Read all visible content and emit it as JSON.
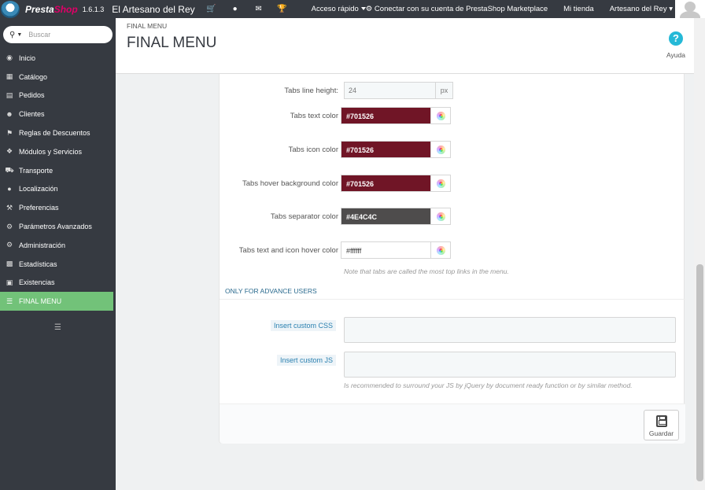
{
  "header": {
    "brand_a": "Presta",
    "brand_b": "Shop",
    "version": "1.6.1.3",
    "shop_name": "El Artesano del Rey",
    "quick_access": "Acceso rápido",
    "marketplace": "Conectar con su cuenta de PrestaShop Marketplace",
    "my_shop": "Mi tienda",
    "user": "Artesano del Rey"
  },
  "sidebar": {
    "search_placeholder": "Buscar",
    "items": [
      {
        "label": "Inicio",
        "icon": "dashboard-icon"
      },
      {
        "label": "Catálogo",
        "icon": "catalog-icon"
      },
      {
        "label": "Pedidos",
        "icon": "credit-card-icon"
      },
      {
        "label": "Clientes",
        "icon": "users-icon"
      },
      {
        "label": "Reglas de Descuentos",
        "icon": "tag-icon"
      },
      {
        "label": "Módulos y Servicios",
        "icon": "puzzle-icon"
      },
      {
        "label": "Transporte",
        "icon": "truck-icon"
      },
      {
        "label": "Localización",
        "icon": "globe-icon"
      },
      {
        "label": "Preferencias",
        "icon": "wrench-icon"
      },
      {
        "label": "Parámetros Avanzados",
        "icon": "cogs-icon"
      },
      {
        "label": "Administración",
        "icon": "gear-icon"
      },
      {
        "label": "Estadísticas",
        "icon": "bar-chart-icon"
      },
      {
        "label": "Existencias",
        "icon": "archive-icon"
      },
      {
        "label": "FINAL MENU",
        "icon": "menu-lines-icon"
      }
    ]
  },
  "page": {
    "breadcrumb": "FINAL MENU",
    "title": "FINAL MENU",
    "help": "Ayuda"
  },
  "form": {
    "line_height": {
      "label": "Tabs line height:",
      "value": "24",
      "unit": "px"
    },
    "colors": [
      {
        "label": "Tabs text color",
        "value": "#701526"
      },
      {
        "label": "Tabs icon color",
        "value": "#701526"
      },
      {
        "label": "Tabs hover background color",
        "value": "#701526"
      },
      {
        "label": "Tabs separator color",
        "value": "#4E4C4C"
      },
      {
        "label": "Tabs text and icon hover color",
        "value": "#ffffff"
      }
    ],
    "note_tabs": "Note that tabs are called the most top links in the menu.",
    "advanced_title": "ONLY FOR ADVANCE USERS",
    "custom_css_label": "Insert custom CSS",
    "custom_js_label": "Insert custom JS",
    "note_js": "Is recommended to surround your JS by jQuery by document ready function or by similar method.",
    "save": "Guardar"
  },
  "theme": {
    "sidebar_bg": "#363a41",
    "active_item": "#72c279",
    "help_blue": "#25b9d7"
  }
}
